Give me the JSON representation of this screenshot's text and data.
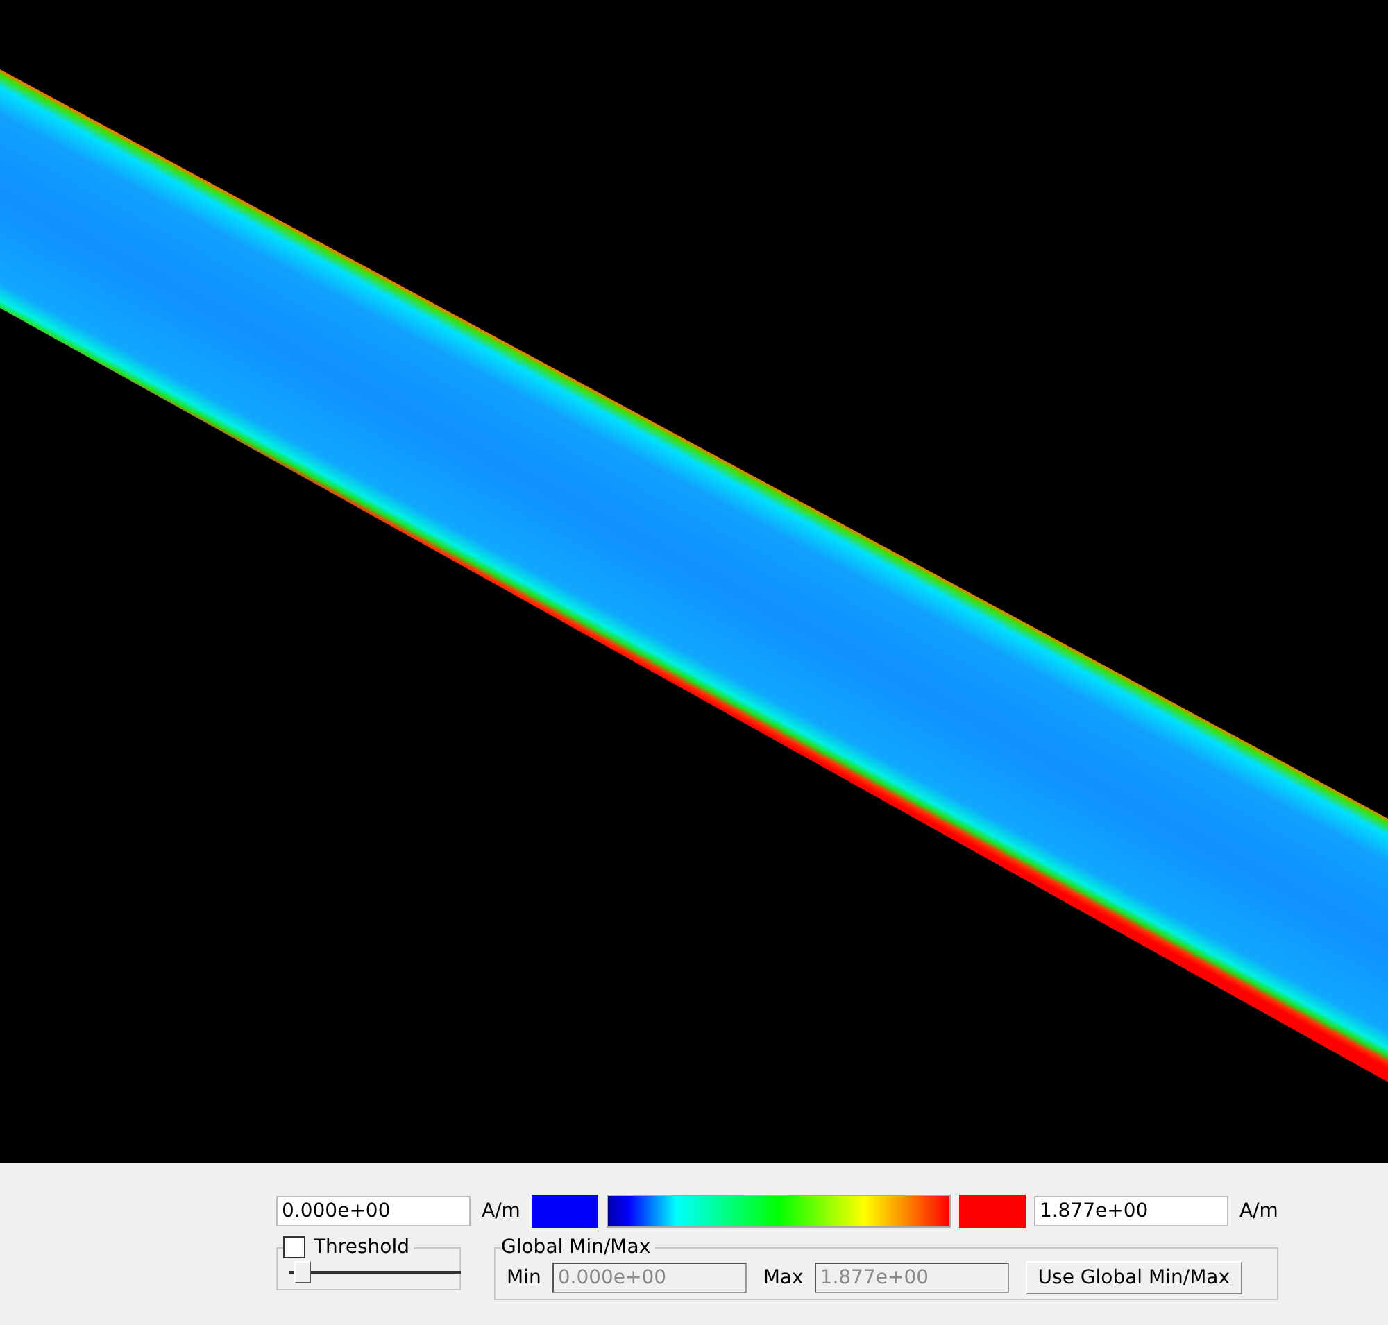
{
  "colorbar": {
    "min_field": {
      "value": "0.000e+00"
    },
    "min_unit": "A/m",
    "max_field": {
      "value": "1.877e+00"
    },
    "max_unit": "A/m"
  },
  "threshold": {
    "label": "Threshold",
    "checked": false,
    "slider": {
      "level": 0.04
    }
  },
  "global_minmax": {
    "title": "Global Min/Max",
    "min_label": "Min",
    "min_field": {
      "value": "0.000e+00",
      "disabled": true
    },
    "max_label": "Max",
    "max_field": {
      "value": "1.877e+00",
      "disabled": true
    },
    "button": "Use Global Min/Max"
  }
}
